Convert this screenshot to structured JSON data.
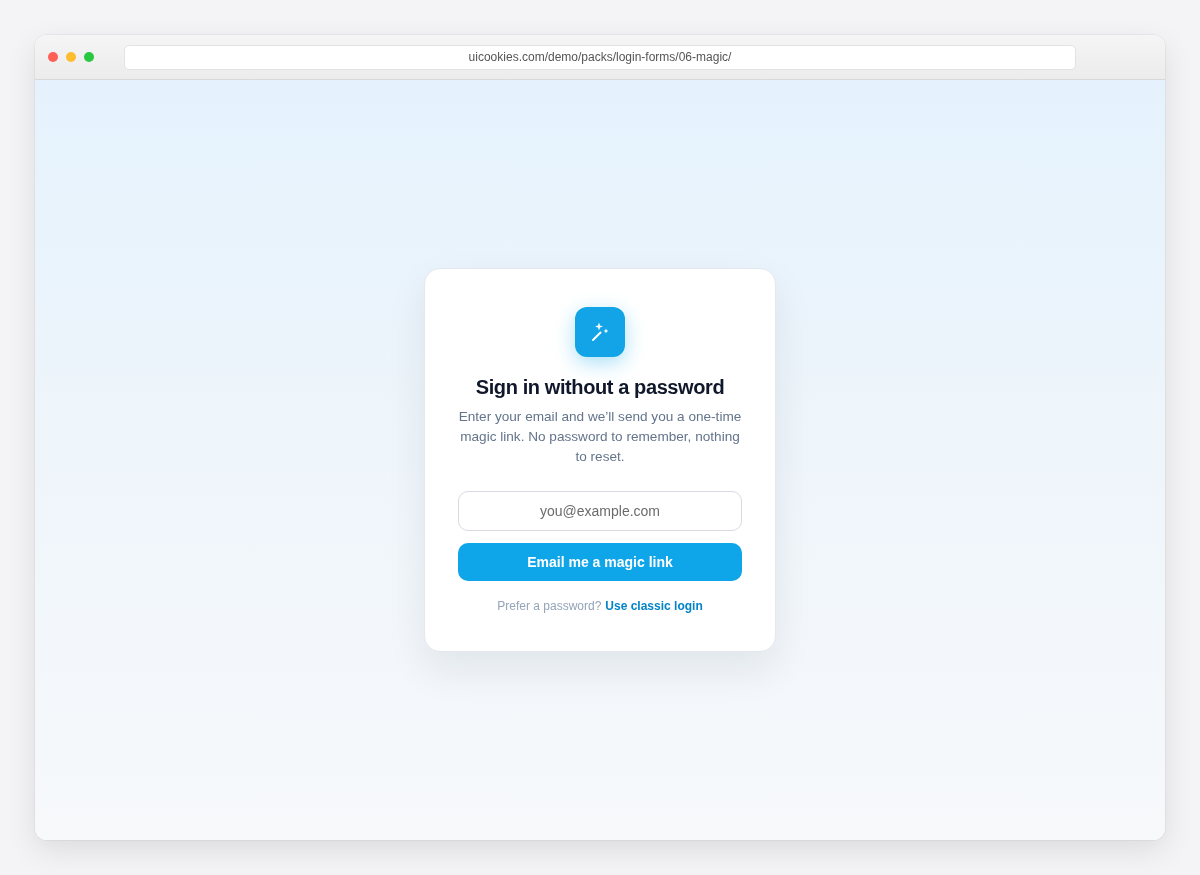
{
  "browser": {
    "url": "uicookies.com/demo/packs/login-forms/06-magic/"
  },
  "card": {
    "title": "Sign in without a password",
    "description": "Enter your email and we’ll send you a one-time magic link. No password to remember, nothing to reset.",
    "email_field": {
      "placeholder": "you@example.com"
    },
    "submit_button": "Email me a magic link",
    "footer": {
      "prompt": "Prefer a password?",
      "link": "Use classic login"
    }
  }
}
